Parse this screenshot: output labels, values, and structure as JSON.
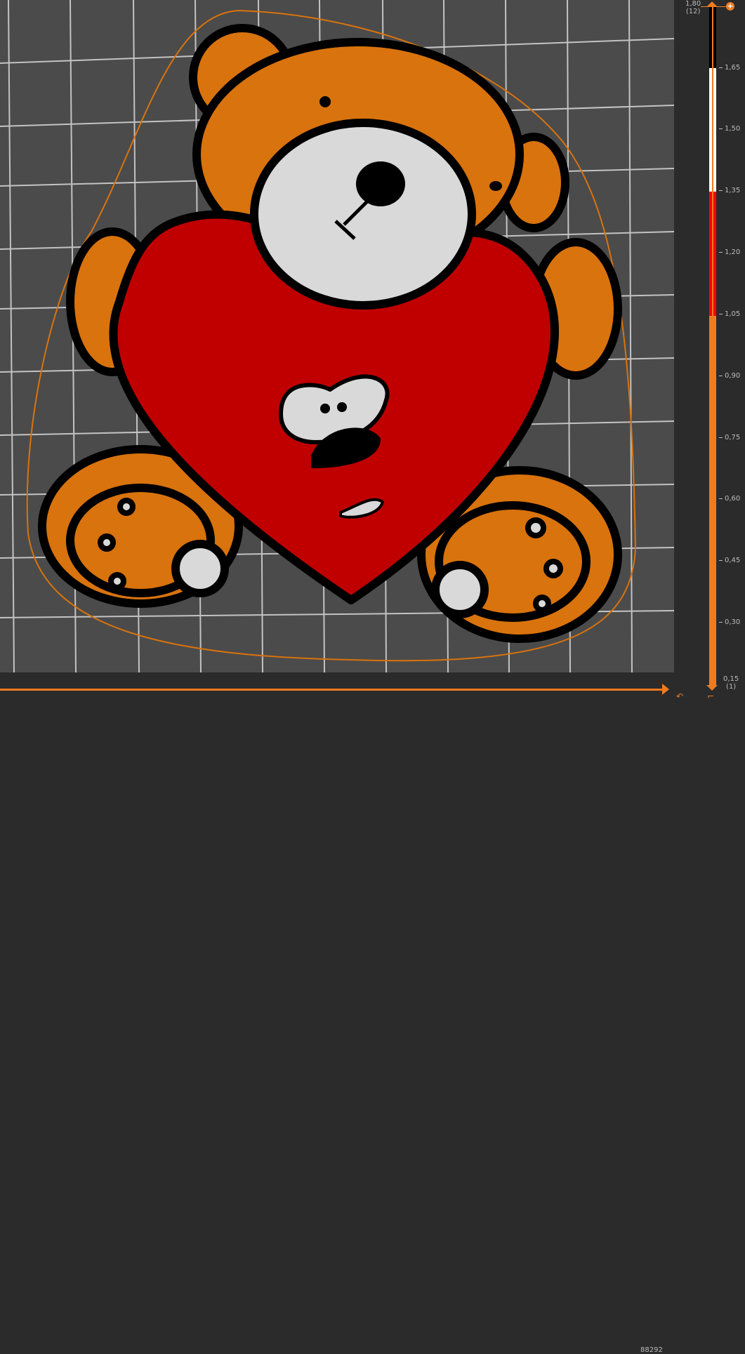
{
  "preview": {
    "move_count": "88292",
    "colors": {
      "orange": "#d9730d",
      "red": "#c00000",
      "white": "#d9d9d9",
      "black": "#000000",
      "accent": "#f07b1f"
    }
  },
  "layer_slider": {
    "top_value": "1,80",
    "top_layer": "(12)",
    "top_right_label": "1,80",
    "bottom_value": "0,15",
    "bottom_layer": "(1)",
    "ticks": [
      "1,65",
      "1,50",
      "1,35",
      "1,20",
      "1,05",
      "0,90",
      "0,75",
      "0,60",
      "0,45",
      "0,30"
    ],
    "color_bands": [
      {
        "from": "1,65",
        "to": "1,80",
        "color": "#000000"
      },
      {
        "from": "1,35",
        "to": "1,65",
        "color": "#ffffff"
      },
      {
        "from": "1,05",
        "to": "1,35",
        "color": "#ff0000"
      },
      {
        "from": "0,15",
        "to": "1,05",
        "color": "#f07b1f"
      }
    ]
  }
}
